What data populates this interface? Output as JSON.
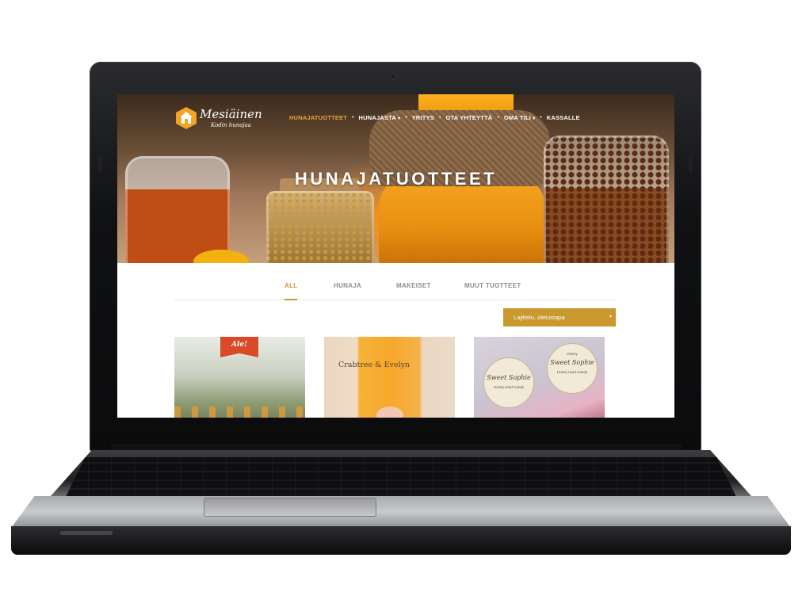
{
  "site": {
    "logo_name": "Mesiäinen",
    "logo_tagline": "Kodin hunajaa",
    "nav": [
      {
        "label": "HUNAJATUOTTEET",
        "active": true,
        "has_dropdown": false
      },
      {
        "label": "HUNAJASTA",
        "active": false,
        "has_dropdown": true
      },
      {
        "label": "YRITYS",
        "active": false,
        "has_dropdown": false
      },
      {
        "label": "OTA YHTEYTTÄ",
        "active": false,
        "has_dropdown": false
      },
      {
        "label": "OMA TILI",
        "active": false,
        "has_dropdown": true
      },
      {
        "label": "KASSALLE",
        "active": false,
        "has_dropdown": false
      }
    ],
    "nav_separator": "•",
    "dropdown_icon": "chevron-down-icon"
  },
  "hero": {
    "title": "HUNAJATUOTTEET"
  },
  "filters": {
    "tabs": [
      {
        "label": "ALL",
        "active": true
      },
      {
        "label": "HUNAJA",
        "active": false
      },
      {
        "label": "MAKEISET",
        "active": false
      },
      {
        "label": "MUUT TUOTTEET",
        "active": false
      }
    ]
  },
  "sort": {
    "selected": "Lajittelu, oletustapa",
    "caret": "▾"
  },
  "products": [
    {
      "badge": "Ale!"
    },
    {
      "label_text": "Crabtree & Evelyn"
    },
    {
      "candy_1_title": "Sweet Sophie",
      "candy_1_sub": "Honey Hard Candy",
      "candy_2_label": "Cherry",
      "candy_2_title": "Sweet Sophie",
      "candy_2_sub": "Honey Hard Candy"
    }
  ],
  "colors": {
    "accent": "#c9982f",
    "nav_active": "#e8a33a",
    "sale_badge": "#d84a28",
    "logo_hex": "#f0a428"
  }
}
